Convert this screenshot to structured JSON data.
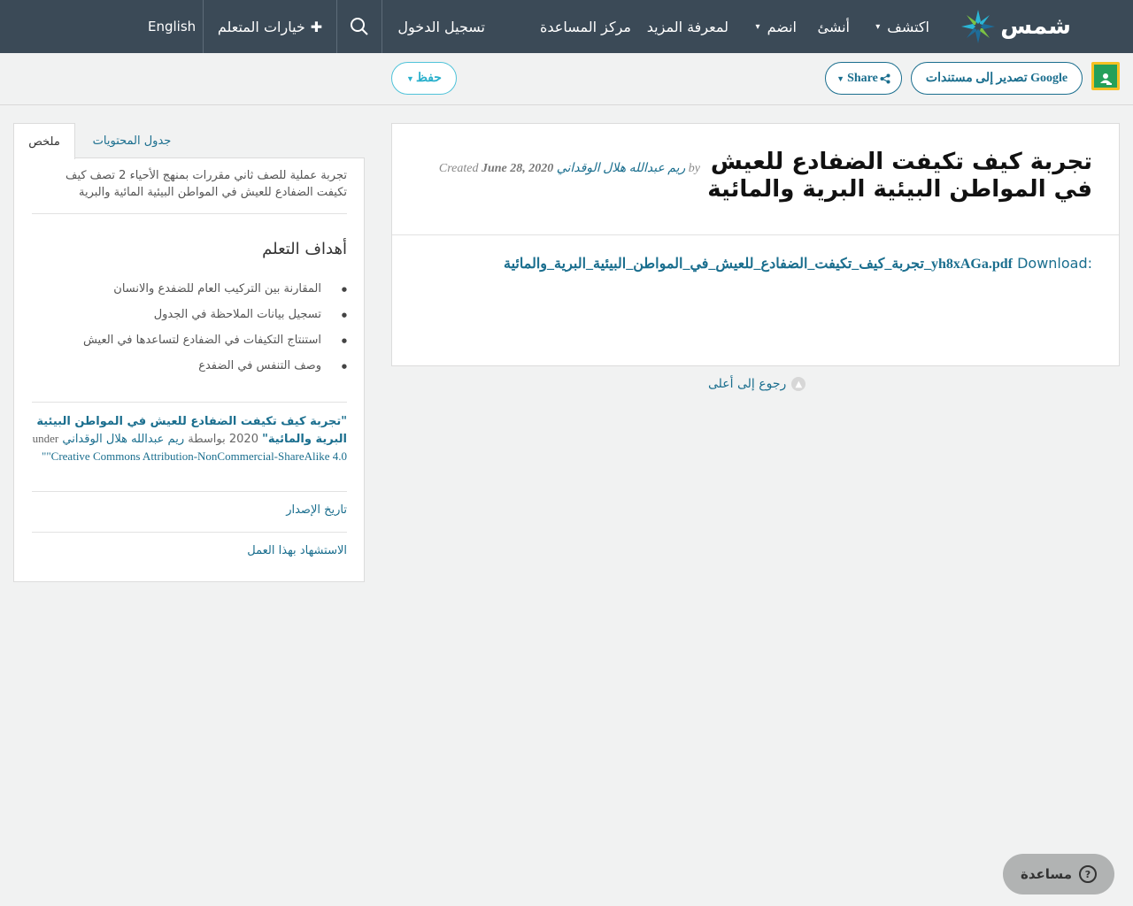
{
  "nav": {
    "logo": "شمس",
    "explore": "اكتشف",
    "create": "أنشئ",
    "join": "انضم",
    "learn_more": "لمعرفة المزيد",
    "help_center": "مركز المساعدة",
    "login": "تسجيل الدخول",
    "learner_options": "خيارات المتعلم",
    "language": "English"
  },
  "toolbar": {
    "export_google": "تصدير إلى مستندات Google",
    "share": "Share",
    "save": "حفظ"
  },
  "resource": {
    "title": "تجربة كيف تكيفت الضفادع للعيش في المواطن البيئية البرية والمائية",
    "by": "by",
    "author": "ريم عبدالله هلال الوقداني",
    "created_label": "Created",
    "created_date": "June 28, 2020",
    "download_label": "Download:",
    "download_file": "تجربة_كيف_تكيفت_الضفادع_للعيش_في_المواطن_البيئية_البرية_والمائية_yh8xAGa.pdf",
    "back_to_top": "رجوع إلى أعلى"
  },
  "sidebar": {
    "tab_summary": "ملخص",
    "tab_toc": "جدول المحتويات",
    "summary_text": "تجربة عملية للصف ثاني مقررات بمنهج الأحياء 2 تصف كيف تكيفت الضفادع للعيش في المواطن البيئية المائية والبرية",
    "objectives_title": "أهداف التعلم",
    "objectives": [
      "المقارنة بين التركيب العام للضفدع والانسان",
      "تسجيل بيانات الملاحظة في الجدول",
      "استنتاج التكيفات في الضفادع لتساعدها في العيش",
      "وصف التنفس في الضفدع"
    ],
    "cite_work": "\"تجربة كيف تكيفت الضفادع للعيش في المواطن البيئية البرية والمائية\"",
    "cite_year": "2020",
    "cite_by": "بواسطة",
    "cite_author": "ريم عبدالله هلال الوقداني",
    "cite_under": "under",
    "cite_license": "\"Creative Commons Attribution-NonCommercial-ShareAlike 4.0\"",
    "release_date": "تاريخ الإصدار",
    "cite_this": "الاستشهاد بهذا العمل"
  },
  "help_button": "مساعدة"
}
